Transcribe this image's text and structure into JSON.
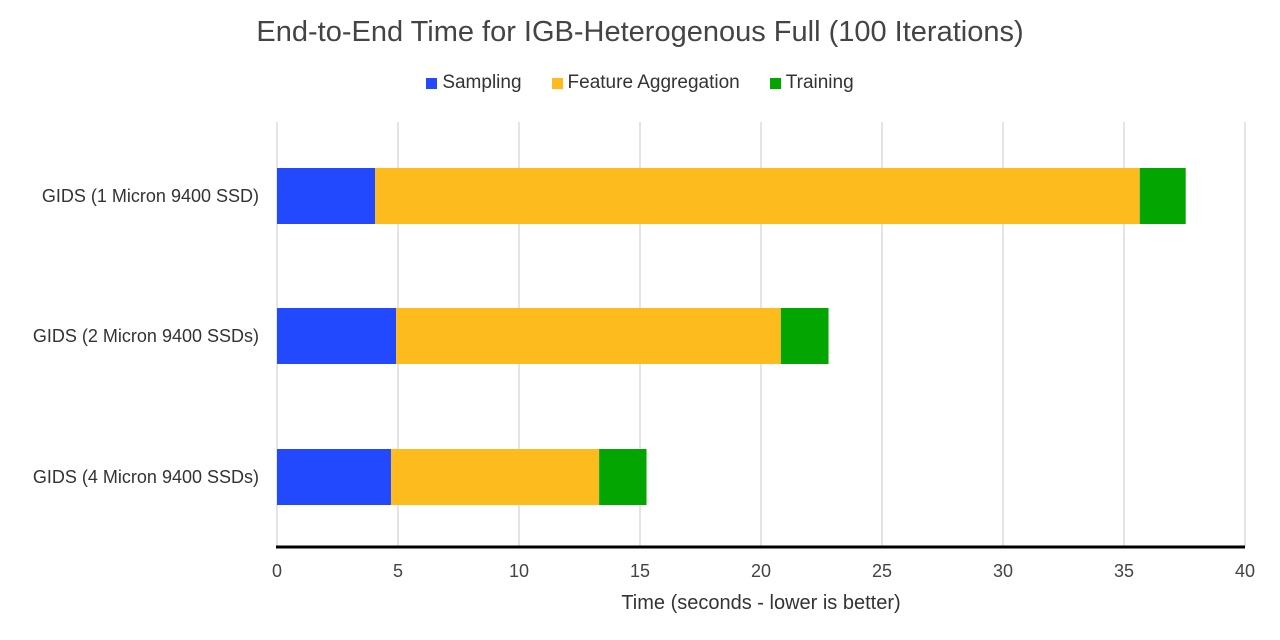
{
  "chart_data": {
    "type": "bar",
    "orientation": "horizontal",
    "stacked": true,
    "title": "End-to-End Time for IGB-Heterogenous Full (100 Iterations)",
    "xlabel": "Time (seconds - lower is better)",
    "ylabel": "",
    "xlim": [
      0,
      40
    ],
    "xticks": [
      0,
      5,
      10,
      15,
      20,
      25,
      30,
      35,
      40
    ],
    "grid": true,
    "legend_position": "top-center",
    "categories": [
      "GIDS (1 Micron 9400 SSD)",
      "GIDS (2 Micron 9400 SSDs)",
      "GIDS (4 Micron 9400 SSDs)"
    ],
    "series": [
      {
        "name": "Sampling",
        "color": "#2349FF",
        "values": [
          4.05,
          4.92,
          4.71
        ]
      },
      {
        "name": "Feature Aggregation",
        "color": "#FDBB1E",
        "values": [
          31.6,
          15.9,
          8.6
        ]
      },
      {
        "name": "Training",
        "color": "#03A600",
        "values": [
          1.9,
          1.97,
          1.96
        ]
      }
    ]
  }
}
